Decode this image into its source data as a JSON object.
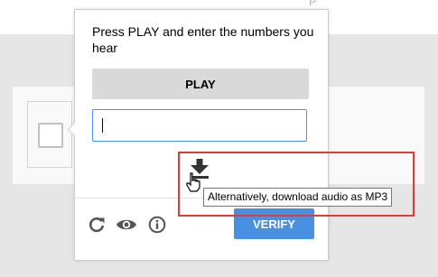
{
  "popup": {
    "instructions": "Press PLAY and enter the numbers you hear",
    "play_label": "PLAY",
    "answer_value": "",
    "verify_label": "VERIFY",
    "icons": {
      "reload": "reload-icon",
      "visual_challenge": "eye-icon",
      "info": "info-icon",
      "download": "download-icon"
    }
  },
  "tooltip": {
    "text": "Alternatively, download audio as MP3"
  },
  "colors": {
    "verify": "#4a90e2",
    "input_focus": "#4d90fe",
    "highlight": "#e53935",
    "play_bg": "#d9d9d9"
  }
}
